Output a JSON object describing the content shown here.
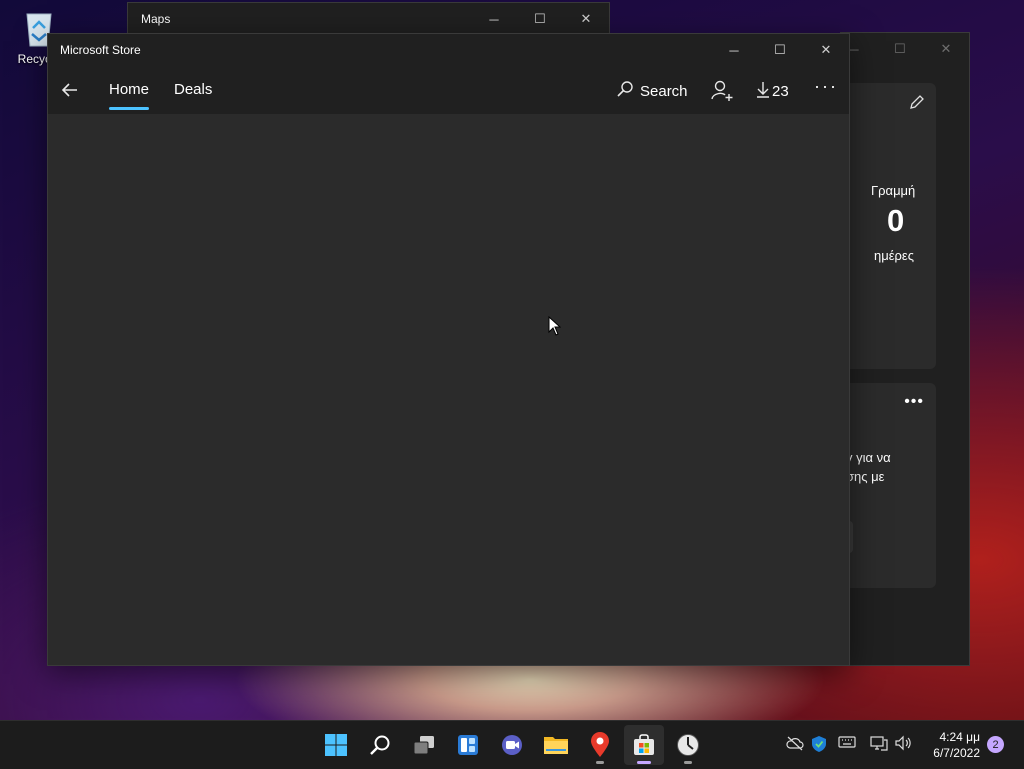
{
  "desktop": {
    "recycle_label": "Recycle"
  },
  "maps_window": {
    "title": "Maps"
  },
  "widget_window": {
    "card1": {
      "label_top": "Γραμμή",
      "value": "0",
      "label_bottom": "ημέρες"
    },
    "card2": {
      "line1": "γ για να",
      "line2": "σης με"
    }
  },
  "store": {
    "title": "Microsoft Store",
    "tabs": [
      {
        "label": "Home"
      },
      {
        "label": "Deals"
      }
    ],
    "search_label": "Search",
    "downloads_count": "23"
  },
  "taskbar": {
    "time": "4:24 μμ",
    "date": "6/7/2022",
    "notifications": "2",
    "accent": "#c5a7ff"
  }
}
